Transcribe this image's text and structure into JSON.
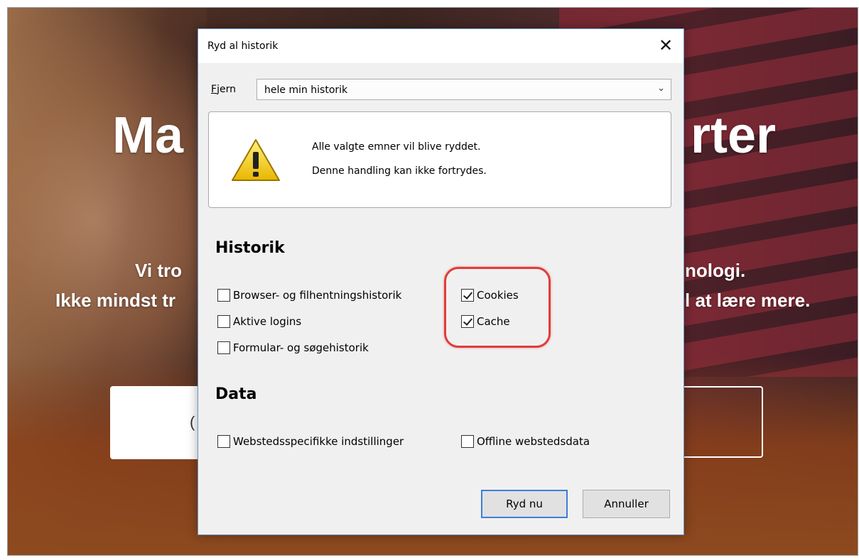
{
  "background_page": {
    "heading_left": "Ma",
    "heading_right": "rter",
    "subtitle_line1_left": "Vi tro",
    "subtitle_line1_right": "nologi.",
    "subtitle_line2_left": "Ikke mindst tr",
    "subtitle_line2_right": "l at lære mere.",
    "button_left_fragment": "("
  },
  "dialog": {
    "title": "Ryd al historik",
    "close_icon": "close-icon",
    "remove_label": "Fjern",
    "remove_accesskey": "F",
    "remove_label_rest": "jern",
    "range": {
      "selected": "hele min historik",
      "icon": "chevron-down-icon"
    },
    "warning": {
      "icon": "warning-triangle-icon",
      "line1": "Alle valgte emner vil blive ryddet.",
      "line2": "Denne handling kan ikke fortrydes."
    },
    "history": {
      "heading": "Historik",
      "items": [
        {
          "label": "Browser- og filhentningshistorik",
          "checked": false
        },
        {
          "label": "Aktive logins",
          "checked": false
        },
        {
          "label": "Formular- og søgehistorik",
          "checked": false
        },
        {
          "label": "Cookies",
          "checked": true
        },
        {
          "label": "Cache",
          "checked": true
        }
      ]
    },
    "data": {
      "heading": "Data",
      "items": [
        {
          "label": "Webstedsspecifikke indstillinger",
          "checked": false
        },
        {
          "label": "Offline webstedsdata",
          "checked": false
        }
      ]
    },
    "buttons": {
      "clear_now": "Ryd nu",
      "cancel": "Annuller"
    },
    "highlight_color": "#e03c3c",
    "accent_color": "#3c7fd6"
  }
}
